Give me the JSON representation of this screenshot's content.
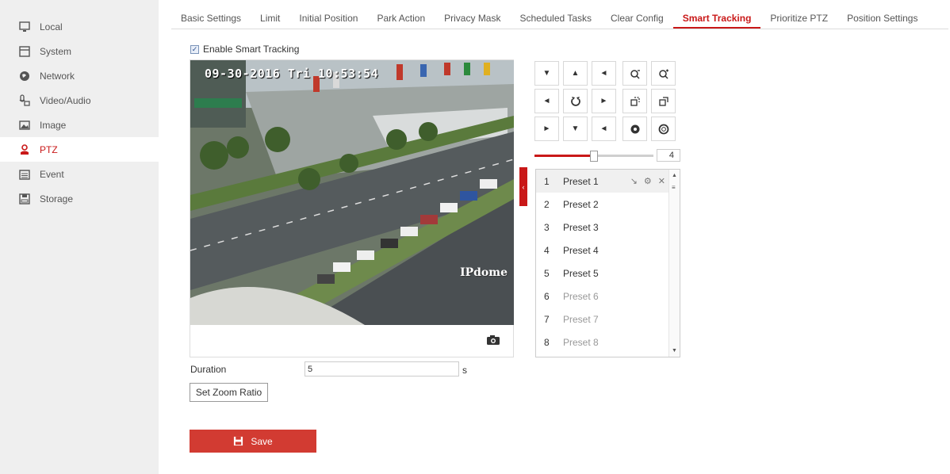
{
  "sidebar": {
    "items": [
      {
        "label": "Local",
        "icon": "monitor-icon"
      },
      {
        "label": "System",
        "icon": "window-icon"
      },
      {
        "label": "Network",
        "icon": "globe-icon"
      },
      {
        "label": "Video/Audio",
        "icon": "mic-camera-icon"
      },
      {
        "label": "Image",
        "icon": "image-icon"
      },
      {
        "label": "PTZ",
        "icon": "ptz-user-icon",
        "active": true
      },
      {
        "label": "Event",
        "icon": "calendar-icon"
      },
      {
        "label": "Storage",
        "icon": "storage-icon"
      }
    ]
  },
  "tabs": [
    "Basic Settings",
    "Limit",
    "Initial Position",
    "Park Action",
    "Privacy Mask",
    "Scheduled Tasks",
    "Clear Config",
    "Smart Tracking",
    "Prioritize PTZ",
    "Position Settings"
  ],
  "active_tab": "Smart Tracking",
  "enable": {
    "label": "Enable Smart Tracking",
    "checked": true
  },
  "video": {
    "osd": "09-30-2016 Tri 10:53:54",
    "watermark": "IPdome"
  },
  "ptz": {
    "speed_value": "4",
    "speed_fraction": 0.5
  },
  "presets": [
    {
      "num": "1",
      "name": "Preset 1",
      "selected": true,
      "dim": false
    },
    {
      "num": "2",
      "name": "Preset 2",
      "selected": false,
      "dim": false
    },
    {
      "num": "3",
      "name": "Preset 3",
      "selected": false,
      "dim": false
    },
    {
      "num": "4",
      "name": "Preset 4",
      "selected": false,
      "dim": false
    },
    {
      "num": "5",
      "name": "Preset 5",
      "selected": false,
      "dim": false
    },
    {
      "num": "6",
      "name": "Preset 6",
      "selected": false,
      "dim": true
    },
    {
      "num": "7",
      "name": "Preset 7",
      "selected": false,
      "dim": true
    },
    {
      "num": "8",
      "name": "Preset 8",
      "selected": false,
      "dim": true
    }
  ],
  "duration": {
    "label": "Duration",
    "value": "5",
    "unit": "s"
  },
  "zoom_button": "Set Zoom Ratio",
  "save_button": "Save",
  "colors": {
    "accent": "#c91818",
    "save": "#d23b32"
  }
}
